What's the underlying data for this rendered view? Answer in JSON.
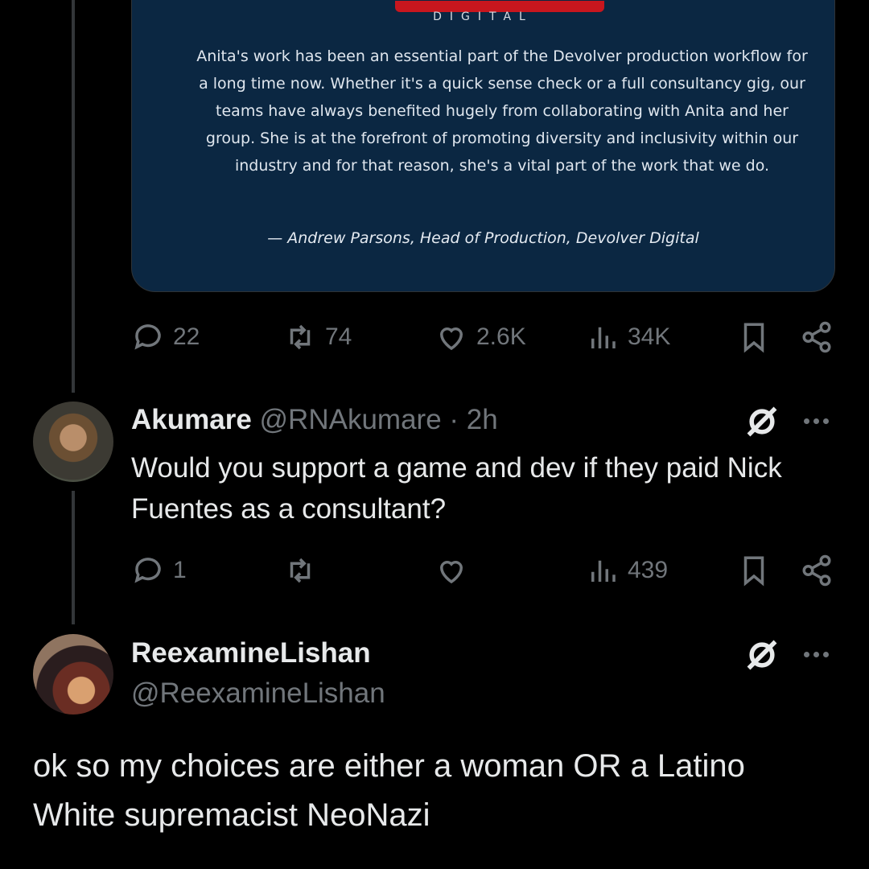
{
  "quote_card": {
    "logo_subtitle": "DIGITAL",
    "quote_text": "Anita's work has been an essential part of the Devolver production workflow for a long time now. Whether it's a quick sense check or a full consultancy gig, our teams have always benefited hugely from collaborating with Anita and her group. She is at the forefront of promoting diversity and inclusivity within our industry and for that reason, she's a vital part of the work that we do.",
    "attribution": "— Andrew Parsons, Head of Production, Devolver Digital"
  },
  "post_actions": {
    "replies": "22",
    "reposts": "74",
    "likes": "2.6K",
    "views": "34K"
  },
  "reply1": {
    "display_name": "Akumare",
    "handle": "@RNAkumare",
    "separator": "·",
    "time": "2h",
    "text": "Would you support a game and dev if they paid Nick Fuentes as a consultant?",
    "actions": {
      "replies": "1",
      "reposts": "",
      "likes": "",
      "views": "439"
    }
  },
  "reply2": {
    "display_name": "ReexamineLishan",
    "handle": "@ReexamineLishan",
    "text": "ok so my choices are either a woman OR a Latino White supremacist NeoNazi"
  },
  "colors": {
    "background": "#000000",
    "card": "#0b2742",
    "muted": "#71767b",
    "text": "#e7e9ea",
    "logo_red": "#c8161e"
  }
}
